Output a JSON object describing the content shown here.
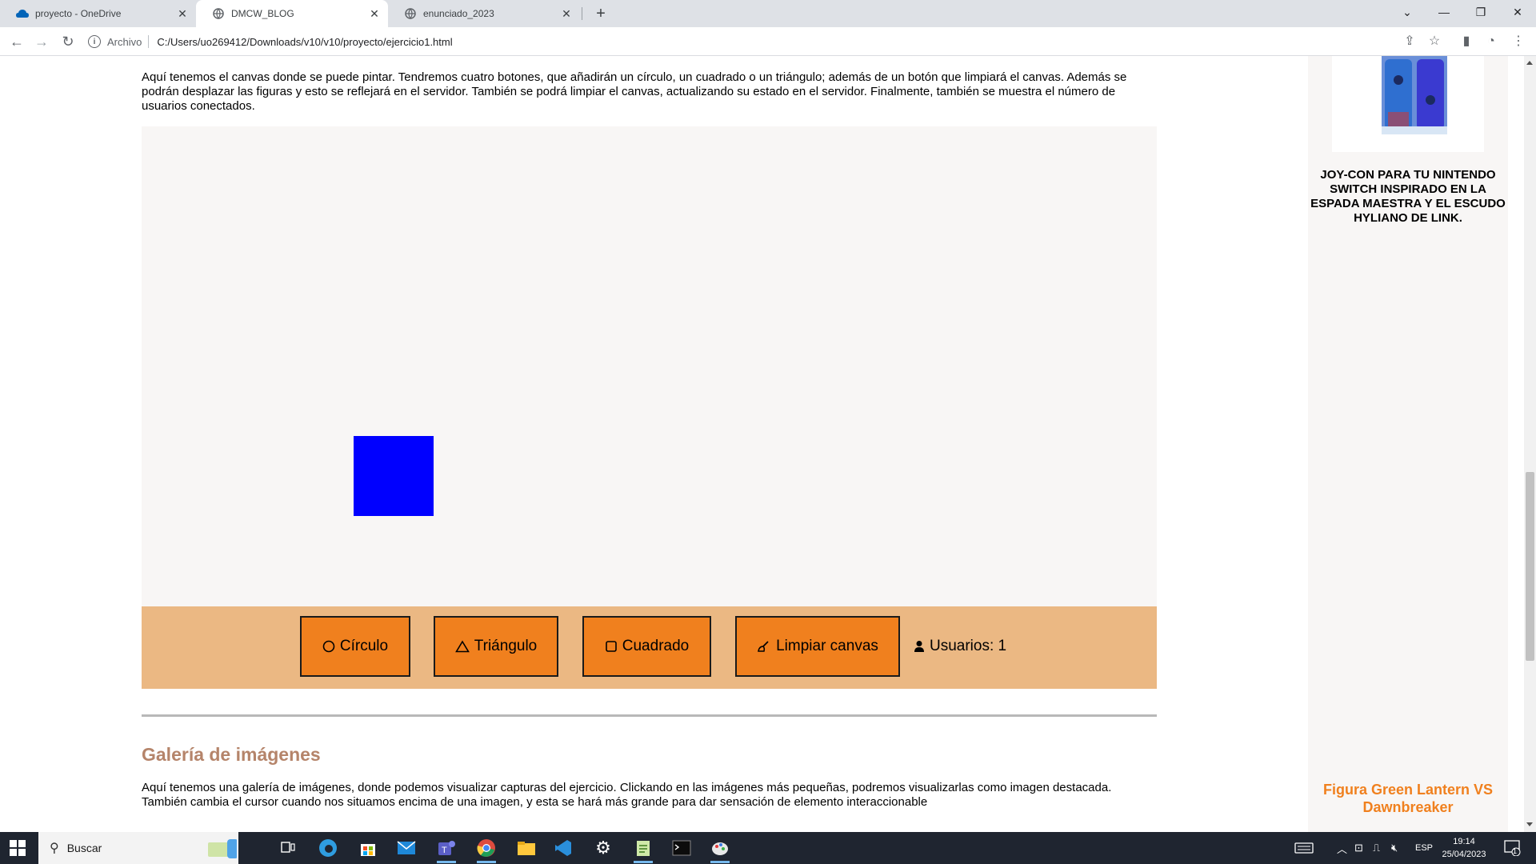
{
  "browser": {
    "tabs": [
      {
        "label": "proyecto - OneDrive",
        "icon": "onedrive-icon",
        "active": false
      },
      {
        "label": "DMCW_BLOG",
        "icon": "globe-icon",
        "active": true
      },
      {
        "label": "enunciado_2023",
        "icon": "globe-icon",
        "active": false
      }
    ],
    "address": {
      "origin_label": "Archivo",
      "url": "C:/Users/uo269412/Downloads/v10/v10/proyecto/ejercicio1.html"
    }
  },
  "page": {
    "intro_text": "Aquí tenemos el canvas donde se puede pintar. Tendremos cuatro botones, que añadirán un círculo, un cuadrado o un triángulo; además de un botón que limpiará el canvas. Además se podrán desplazar las figuras y esto se reflejará en el servidor. También se podrá limpiar el canvas, actualizando su estado en el servidor. Finalmente, también se muestra el número de usuarios conectados.",
    "canvas": {
      "shapes": [
        {
          "type": "square",
          "color": "#0000ff"
        }
      ]
    },
    "controls": {
      "circle_label": "Círculo",
      "triangle_label": "Triángulo",
      "square_label": "Cuadrado",
      "clear_label": "Limpiar canvas",
      "users_label": "Usuarios: 1"
    },
    "gallery": {
      "title": "Galería de imágenes",
      "text": "Aquí tenemos una galería de imágenes, donde podemos visualizar capturas del ejercicio. Clickando en las imágenes más pequeñas, podremos visualizarlas como imagen destacada. También cambia el cursor cuando nos situamos encima de una imagen, y esta se hará más grande para dar sensación de elemento interaccionable"
    },
    "sidebar": {
      "product1_caption": "JOY-CON PARA TU NINTENDO SWITCH INSPIRADO EN LA ESPADA MAESTRA Y EL ESCUDO HYLIANO DE LINK.",
      "product2_title": "Figura Green Lantern VS Dawnbreaker"
    }
  },
  "taskbar": {
    "search_placeholder": "Buscar",
    "language": "ESP",
    "time": "19:14",
    "date": "25/04/2023",
    "notification_count": "1"
  },
  "colors": {
    "button_bg": "#f0801e",
    "controls_bg": "#ebb883",
    "canvas_bg": "#f8f6f5",
    "square": "#0000ff",
    "section_title": "#b5846a",
    "product_title": "#f0801e"
  }
}
